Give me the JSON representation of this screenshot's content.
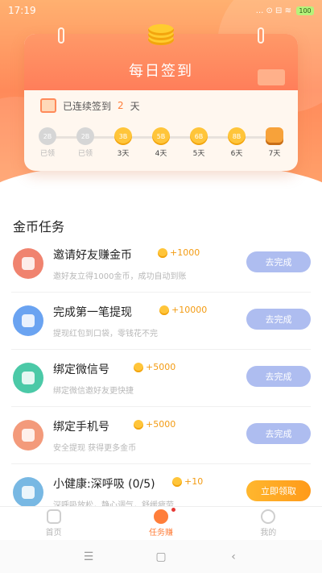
{
  "status": {
    "time": "17:19",
    "icons": "... ⊙ ⊟ ≋",
    "battery": "100"
  },
  "checkin": {
    "title": "每日签到",
    "streak_prefix": "已连续签到",
    "streak_days": "2",
    "streak_suffix": "天",
    "days": [
      {
        "coin": "2B",
        "label": "已领",
        "done": true
      },
      {
        "coin": "2B",
        "label": "已领",
        "done": true
      },
      {
        "coin": "3B",
        "label": "3天",
        "done": false
      },
      {
        "coin": "5B",
        "label": "4天",
        "done": false
      },
      {
        "coin": "6B",
        "label": "5天",
        "done": false
      },
      {
        "coin": "8B",
        "label": "6天",
        "done": false
      },
      {
        "coin": "",
        "label": "7天",
        "done": false,
        "chest": true
      }
    ]
  },
  "tasks": {
    "title": "金币任务",
    "items": [
      {
        "name": "邀请好友赚金币",
        "reward": "+1000",
        "desc": "邀好友立得1000金币，成功自动到账",
        "button": "去完成",
        "icon": "invite-user-icon",
        "color": "#f0836f"
      },
      {
        "name": "完成第一笔提现",
        "reward": "+10000",
        "desc": "提现红包到口袋，零钱花不完",
        "button": "去完成",
        "icon": "withdraw-icon",
        "color": "#6aa3f1"
      },
      {
        "name": "绑定微信号",
        "reward": "+5000",
        "desc": "绑定微信邀好友更快捷",
        "button": "去完成",
        "icon": "wechat-icon",
        "color": "#4bc9a7"
      },
      {
        "name": "绑定手机号",
        "reward": "+5000",
        "desc": "安全提现 获得更多金币",
        "button": "去完成",
        "icon": "phone-icon",
        "color": "#f39a7b"
      },
      {
        "name": "小健康:深呼吸 (0/5)",
        "reward": "+10",
        "desc": "深呼吸放松，静心调气，舒缓疲劳",
        "button": "立即领取",
        "icon": "breath-icon",
        "color": "#78b8e3"
      }
    ]
  },
  "bottom_nav": {
    "home": "首页",
    "tasks": "任务赚",
    "me": "我的"
  },
  "system_nav": {
    "menu": "☰",
    "home": "▢",
    "back": "‹"
  }
}
